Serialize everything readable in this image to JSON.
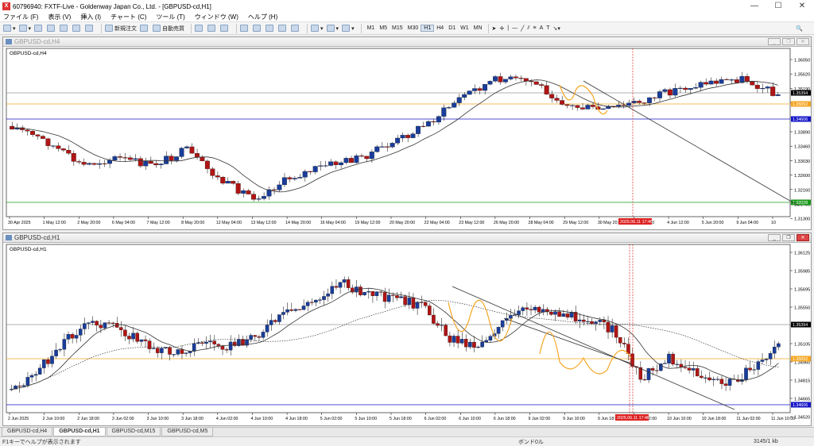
{
  "window": {
    "title": "60796940: FXTF-Live - Goldenway Japan Co., Ltd. - [GBPUSD-cd,H1]"
  },
  "menu": [
    "ファイル (F)",
    "表示 (V)",
    "挿入 (I)",
    "チャート (C)",
    "ツール (T)",
    "ウィンドウ (W)",
    "ヘルプ (H)"
  ],
  "toolbar": {
    "new_order": "新規注文",
    "auto_trade": "自動売買",
    "timeframes": [
      "M1",
      "M5",
      "M15",
      "M30",
      "H1",
      "H4",
      "D1",
      "W1",
      "MN"
    ],
    "active_timeframe": "H1"
  },
  "charts": {
    "top": {
      "window_title": "GBPUSD-cd,H4",
      "label": "GBPUSD-cd,H4",
      "price_labels": [
        "1.36050",
        "1.35620",
        "1.35190",
        "1.34750",
        "1.34320",
        "1.33890",
        "1.33460",
        "1.33030",
        "1.32600",
        "1.32160",
        "1.31730",
        "1.31300"
      ],
      "tagged": [
        {
          "text": "1.35394",
          "color": "#000000"
        },
        {
          "text": "1.35052",
          "color": "#f5a623"
        },
        {
          "text": "1.34606",
          "color": "#1515c8"
        },
        {
          "text": "1.32028",
          "color": "#1a9a1a"
        }
      ],
      "time_labels": [
        "30 Apr 2025",
        "1 May 12:00",
        "2 May 20:00",
        "6 May 04:00",
        "7 May 12:00",
        "8 May 20:00",
        "12 May 04:00",
        "13 May 12:00",
        "14 May 20:00",
        "16 May 04:00",
        "19 May 12:00",
        "20 May 20:00",
        "22 May 04:00",
        "23 May 12:00",
        "26 May 20:00",
        "28 May 04:00",
        "29 May 12:00",
        "30 May 20:00",
        "3 Jun 04:00",
        "4 Jun 12:00",
        "5 Jun 20:00",
        "9 Jun 04:00",
        "10"
      ],
      "cursor_time": "2025.06.11 17:46"
    },
    "bottom": {
      "window_title": "GBPUSD-cd,H1",
      "label": "GBPUSD-cd,H1",
      "price_labels": [
        "1.36125",
        "1.35985",
        "1.35695",
        "1.35550",
        "1.35250",
        "1.35105",
        "1.34960",
        "1.34815",
        "1.34665",
        "1.34520"
      ],
      "tagged": [
        {
          "text": "1.35394",
          "color": "#000000"
        },
        {
          "text": "1.35052",
          "color": "#f5a623"
        },
        {
          "text": "1.34606",
          "color": "#1515c8"
        }
      ],
      "time_labels": [
        "2 Jun 2025",
        "2 Jun 10:00",
        "2 Jun 18:00",
        "3 Jun 02:00",
        "3 Jun 10:00",
        "3 Jun 18:00",
        "4 Jun 02:00",
        "4 Jun 10:00",
        "4 Jun 18:00",
        "5 Jun 02:00",
        "5 Jun 10:00",
        "5 Jun 18:00",
        "6 Jun 02:00",
        "6 Jun 10:00",
        "6 Jun 18:00",
        "9 Jun 02:00",
        "9 Jun 10:00",
        "9 Jun 18:00",
        "10 Jun 02:00",
        "10 Jun 10:00",
        "10 Jun 18:00",
        "11 Jun 02:00",
        "11 Jun 10:00"
      ],
      "cursor_time": "2025.06.11 17:46"
    }
  },
  "tabs": [
    "GBPUSD-cd,H4",
    "GBPUSD-cd,H1",
    "GBPUSD-cd,M15",
    "GBPUSD-cd,M5"
  ],
  "active_tab": "GBPUSD-cd,H1",
  "status": {
    "help": "F1キーでヘルプが表示されます",
    "profile": "ボンド0ル",
    "traffic": "3145/1 kb"
  },
  "colors": {
    "bull": "#1a3d9a",
    "bear": "#b01515",
    "support": "#1515c8",
    "resistance_orange": "#f5a623",
    "green_level": "#1a9a1a"
  }
}
